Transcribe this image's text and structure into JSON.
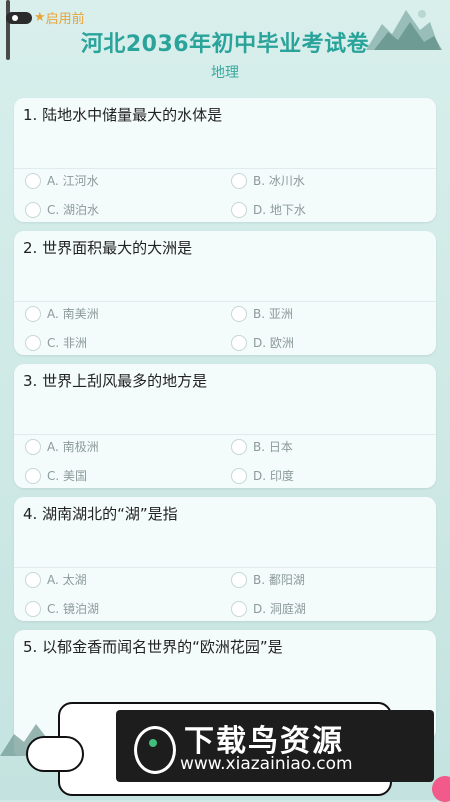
{
  "header": {
    "badge_label": "启用前",
    "title": "河北2036年初中毕业考试卷",
    "subject": "地理"
  },
  "questions": [
    {
      "text": "1.  陆地水中储量最大的水体是",
      "options": [
        "A. 江河水",
        "B. 冰川水",
        "C. 湖泊水",
        "D. 地下水"
      ]
    },
    {
      "text": "2.  世界面积最大的大洲是",
      "options": [
        "A. 南美洲",
        "B. 亚洲",
        "C. 非洲",
        "D. 欧洲"
      ]
    },
    {
      "text": "3.  世界上刮风最多的地方是",
      "options": [
        "A. 南极洲",
        "B. 日本",
        "C. 美国",
        "D. 印度"
      ]
    },
    {
      "text": "4.  湖南湖北的“湖”是指",
      "options": [
        "A. 太湖",
        "B. 鄱阳湖",
        "C. 镜泊湖",
        "D. 洞庭湖"
      ]
    },
    {
      "text": "5.  以郁金香而闻名世界的“欧洲花园”是",
      "options": []
    }
  ],
  "watermark": {
    "brand": "下载鸟资源",
    "url": "www.xiazainiao.com"
  },
  "colors": {
    "accent": "#2aa39a",
    "background": "#cfe9e7",
    "card": "#f4fbfb"
  }
}
